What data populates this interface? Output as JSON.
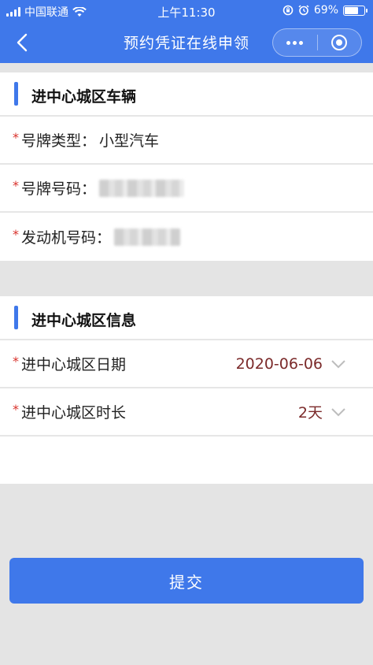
{
  "status": {
    "carrier": "中国联通",
    "time": "上午11:30",
    "battery": "69%",
    "battery_level": 0.69,
    "icons": [
      "signal-icon",
      "wifi-icon",
      "rotation-lock-icon",
      "alarm-icon",
      "battery-icon"
    ]
  },
  "nav": {
    "title": "预约凭证在线申领",
    "back_icon": "chevron-left-icon",
    "menu_icon": "more-dots-icon",
    "close_icon": "target-icon"
  },
  "vehicle_section": {
    "title": "进中心城区车辆",
    "rows": [
      {
        "label": "号牌类型：",
        "value": "小型汽车",
        "required": "*"
      },
      {
        "label": "号牌号码：",
        "value": "",
        "required": "*"
      },
      {
        "label": "发动机号码：",
        "value": "",
        "required": "*"
      }
    ]
  },
  "entry_section": {
    "title": "进中心城区信息",
    "rows": [
      {
        "label": "进中心城区日期",
        "value": "2020-06-06",
        "required": "*"
      },
      {
        "label": "进中心城区时长",
        "value": "2天",
        "required": "*"
      }
    ]
  },
  "submit_label": "提交",
  "colors": {
    "accent": "#3f78ea",
    "required": "#d9322b",
    "picker_value": "#7b2a2a",
    "background": "#e4e4e4"
  }
}
